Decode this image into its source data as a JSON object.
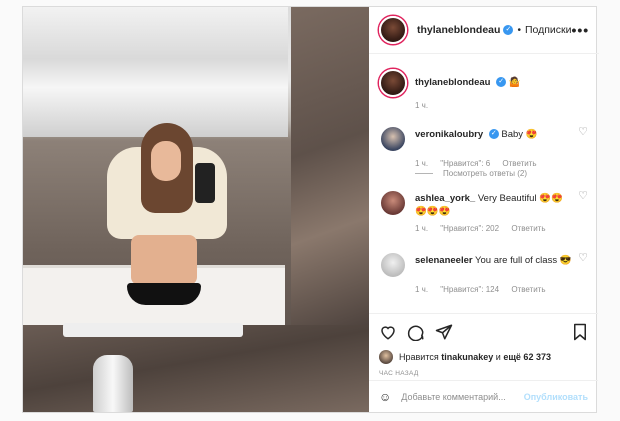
{
  "post": {
    "username": "thylaneblondeau",
    "follow_label": "Подписки",
    "dot": "•",
    "more": "•••"
  },
  "caption": {
    "username": "thylaneblondeau",
    "emoji": "🤷",
    "time": "1 ч."
  },
  "comments": [
    {
      "username": "veronikaloubry",
      "text": "Baby 😍",
      "time": "1 ч.",
      "likes": "\"Нравится\": 6",
      "reply": "Ответить"
    },
    {
      "username": "ashlea_york_",
      "text": "Very Beautiful 😍😍 😍😍😍",
      "time": "1 ч.",
      "likes": "\"Нравится\": 202",
      "reply": "Ответить"
    },
    {
      "username": "selenaneeler",
      "text": "You are full of class 😎",
      "time": "1 ч.",
      "likes": "\"Нравится\": 124",
      "reply": "Ответить"
    }
  ],
  "view_replies": "Посмотреть ответы (2)",
  "likes_line": {
    "prefix": "Нравится",
    "user": "tinakunakey",
    "middle": "и",
    "count": "ещё 62 373"
  },
  "time_caption": "ЧАС НАЗАД",
  "add_comment": {
    "placeholder": "Добавьте комментарий...",
    "post": "Опубликовать"
  },
  "icons": {
    "verified": "✓",
    "heart": "♡",
    "emoji": "☺"
  }
}
